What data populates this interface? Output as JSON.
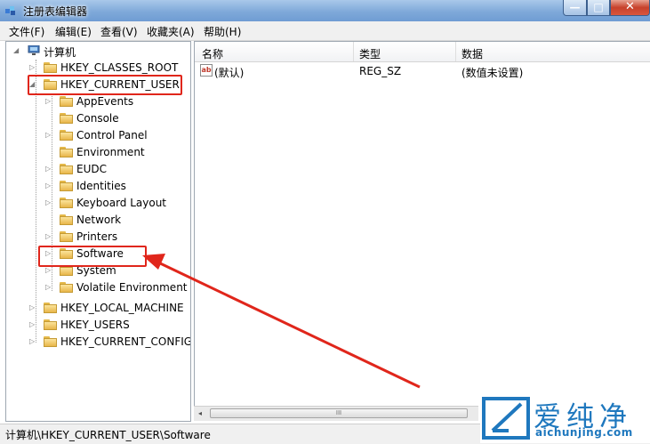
{
  "window": {
    "title": "注册表编辑器",
    "minimize_glyph": "—",
    "maximize_glyph": "□",
    "close_glyph": "✕"
  },
  "menu": [
    "文件(F)",
    "编辑(E)",
    "查看(V)",
    "收藏夹(A)",
    "帮助(H)"
  ],
  "tree": {
    "root": "计算机",
    "hives": [
      "HKEY_CLASSES_ROOT",
      "HKEY_CURRENT_USER",
      "HKEY_LOCAL_MACHINE",
      "HKEY_USERS",
      "HKEY_CURRENT_CONFIG"
    ],
    "hkcu_children": [
      "AppEvents",
      "Console",
      "Control Panel",
      "Environment",
      "EUDC",
      "Identities",
      "Keyboard Layout",
      "Network",
      "Printers",
      "Software",
      "System",
      "Volatile Environment"
    ],
    "expand_glyph": "▷",
    "expanded_glyph": "◢"
  },
  "list": {
    "columns": [
      "名称",
      "类型",
      "数据"
    ],
    "rows": [
      {
        "name": "(默认)",
        "type": "REG_SZ",
        "data": "(数值未设置)"
      }
    ],
    "icon_text": "ab"
  },
  "scrollbar": {
    "left_arrow": "◂",
    "thumb_grip": "III"
  },
  "status": {
    "path": "计算机\\HKEY_CURRENT_USER\\Software"
  },
  "watermark": {
    "brand": "爱纯净",
    "url": "aichunjing.com"
  },
  "colors": {
    "highlight": "#e0261b",
    "arrow": "#e0261b",
    "watermark": "#1f78be"
  },
  "icons": {
    "app": "regedit-icon",
    "folder": "folder-icon",
    "computer": "computer-icon",
    "value": "string-value-icon"
  }
}
